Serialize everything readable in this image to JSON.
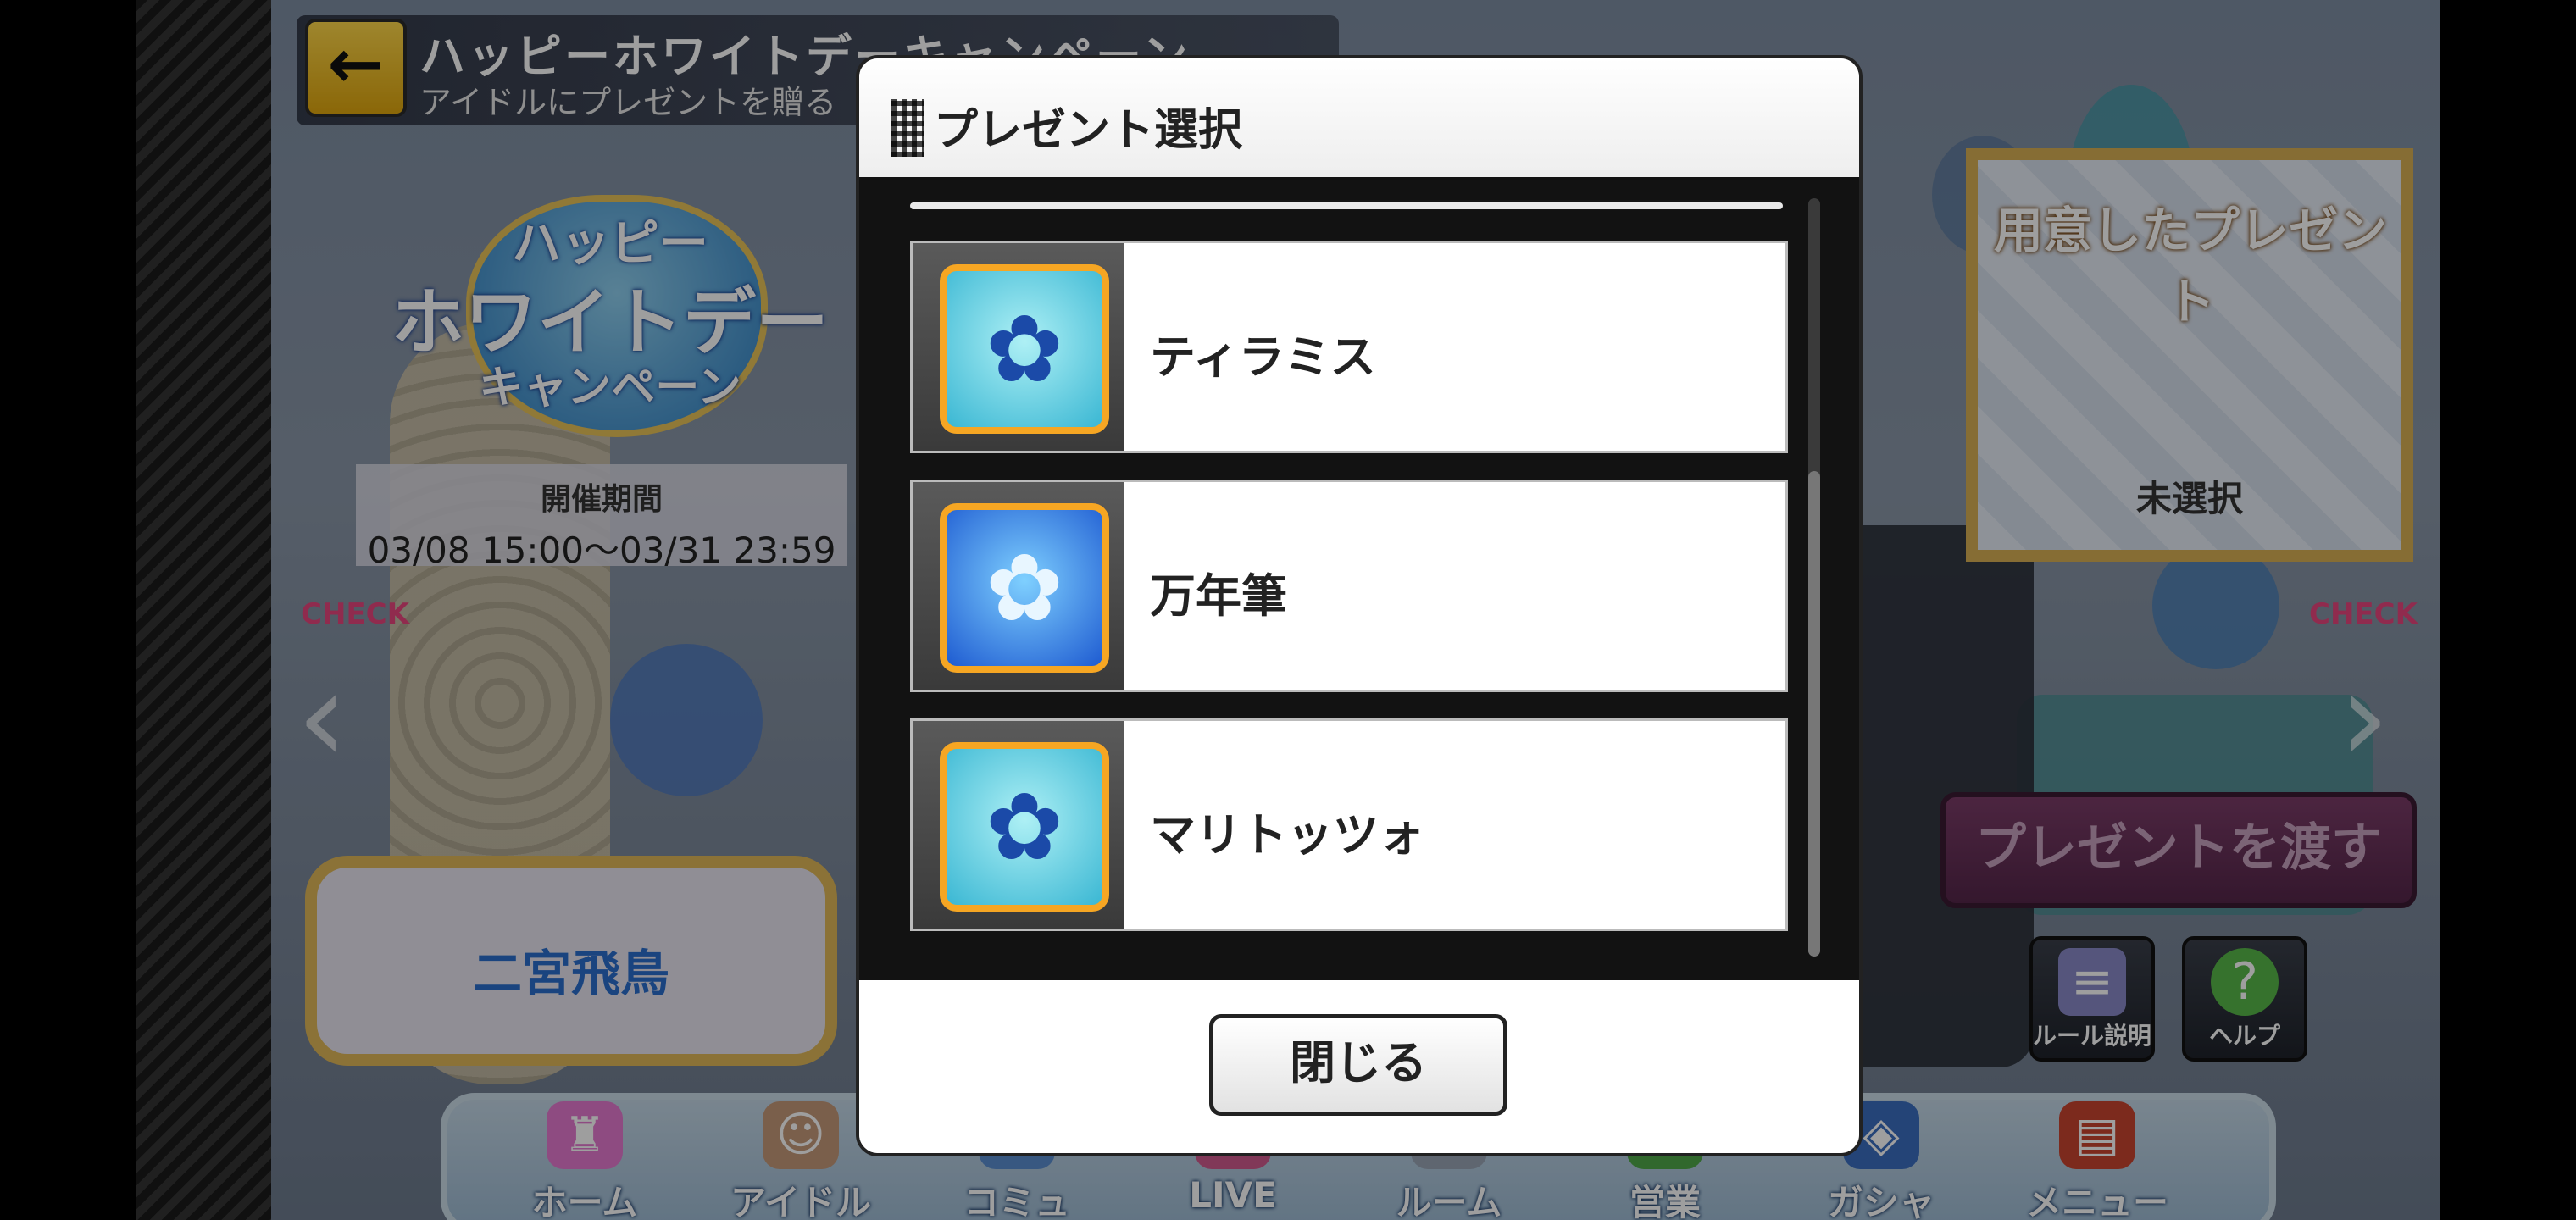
{
  "header": {
    "title": "ハッピーホワイトデーキャンペーン",
    "subtitle": "アイドルにプレゼントを贈る",
    "back_icon": "back-arrow-icon"
  },
  "logo": {
    "line1": "ハッピー",
    "line2": "ホワイトデー",
    "line3": "キャンペーン"
  },
  "period": {
    "label": "開催期間",
    "value": "03/08 15:00～03/31 23:59"
  },
  "check_label": "CHECK",
  "idol_name": "二宮飛鳥",
  "prepared_panel": {
    "title": "用意したプレゼント",
    "status": "未選択"
  },
  "give_button": "プレゼントを渡す",
  "side_buttons": {
    "rules": "ルール説明",
    "help": "ヘルプ"
  },
  "nav": {
    "items": [
      {
        "label": "ホーム",
        "icon": "castle-icon"
      },
      {
        "label": "アイドル",
        "icon": "idol-icon"
      },
      {
        "label": "コミュ",
        "icon": "chat-icon"
      },
      {
        "label": "LIVE",
        "icon": "live-icon"
      },
      {
        "label": "ルーム",
        "icon": "room-icon"
      },
      {
        "label": "営業",
        "icon": "work-icon"
      },
      {
        "label": "ガシャ",
        "icon": "gacha-icon"
      },
      {
        "label": "メニュー",
        "icon": "menu-book-icon"
      }
    ]
  },
  "dialog": {
    "title": "プレゼント選択",
    "items": [
      {
        "name": "ティラミス",
        "icon": "gift-bag-icon"
      },
      {
        "name": "万年筆",
        "icon": "gift-box-icon"
      },
      {
        "name": "マリトッツォ",
        "icon": "gift-bag-icon"
      }
    ],
    "close_label": "閉じる"
  },
  "colors": {
    "accent_gold": "#e0b85a",
    "give_button": "#7b3c68",
    "item_border": "#f6a623"
  }
}
